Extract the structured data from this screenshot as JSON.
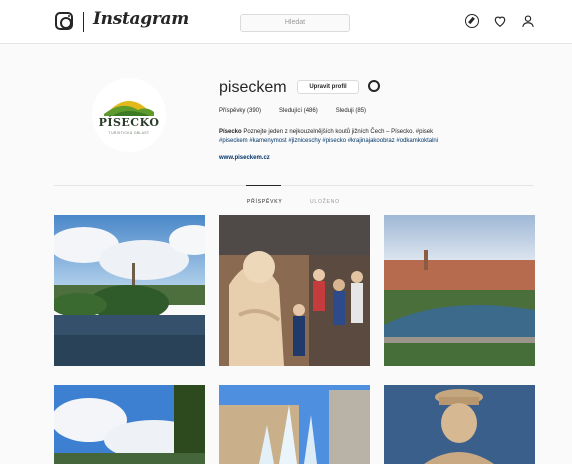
{
  "header": {
    "wordmark": "Instagram",
    "search_placeholder": "Hledat"
  },
  "profile": {
    "username": "piseckem",
    "edit_label": "Upravit profil",
    "avatar_logo_text": "PÍSECKO",
    "avatar_logo_subtext": "TURISTICKÁ OBLAST",
    "stats": {
      "posts": "Příspěvky (390)",
      "followers": "Sledující (486)",
      "following": "Sleduji (85)"
    },
    "bio_name": "Písecko",
    "bio_text": " Poznejte jeden z nejkouzelnějších koutů jižních Čech – Písecko. #pisek",
    "bio_hashtags": "#piseckem #kamenymost #jizniceschy #pisecko #krajinajakoobraz #odkamkoktalni",
    "website": "www.piseckem.cz"
  },
  "tabs": {
    "posts": "PŘÍSPĚVKY",
    "saved": "ULOŽENO"
  },
  "colors": {
    "accent_link": "#003569",
    "border": "#dbdbdb",
    "background": "#fafafa"
  },
  "icons": {
    "logo": "instagram-camera-icon",
    "explore": "compass-icon",
    "activity": "heart-icon",
    "profile": "user-icon",
    "settings": "gear-icon"
  }
}
